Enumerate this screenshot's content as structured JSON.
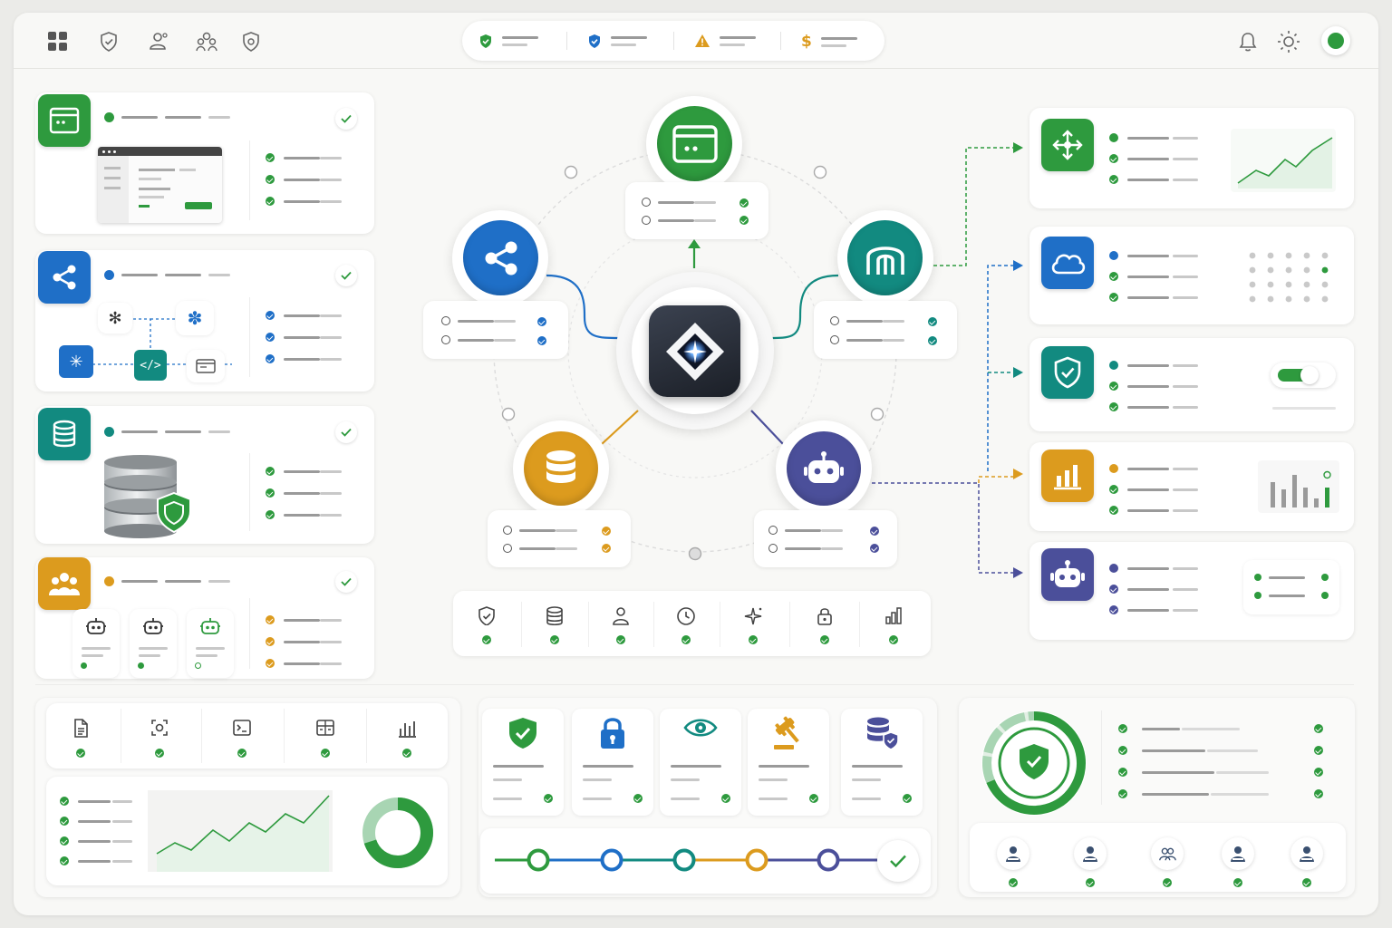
{
  "top_toolbar": {
    "left_icons": [
      "grid-icon",
      "shield-check-icon",
      "user-network-icon",
      "users-icon",
      "shield-settings-icon"
    ],
    "status_pills": [
      {
        "icon": "shield-check-icon",
        "color": "#2e9a3e"
      },
      {
        "icon": "shield-check-icon",
        "color": "#1f6fc7"
      },
      {
        "icon": "warning-icon",
        "color": "#dc9b1e"
      },
      {
        "icon": "dollar-icon",
        "color": "#dc9b1e"
      }
    ],
    "right_icons": [
      "bell-icon",
      "sun-icon",
      "status-online-icon"
    ]
  },
  "left_cards": [
    {
      "icon": "browser-window-icon",
      "color": "#2e9a3e",
      "status": "green"
    },
    {
      "icon": "share-icon",
      "color": "#1f6fc7",
      "status": "blue"
    },
    {
      "icon": "database-icon",
      "color": "#128a80",
      "status": "teal"
    },
    {
      "icon": "team-icon",
      "color": "#dc9b1e",
      "status": "orange"
    }
  ],
  "hub": {
    "center_icon": "diamond-spark-icon",
    "nodes": [
      {
        "icon": "browser-window-icon",
        "color": "#2e9a3e"
      },
      {
        "icon": "share-icon",
        "color": "#1f6fc7"
      },
      {
        "icon": "gateway-icon",
        "color": "#128a80"
      },
      {
        "icon": "database-icon",
        "color": "#dc9b1e"
      },
      {
        "icon": "robot-icon",
        "color": "#4b4f9a"
      }
    ]
  },
  "capability_bar": [
    "shield-check-icon",
    "database-icon",
    "user-icon",
    "clock-icon",
    "sparkle-icon",
    "lock-icon",
    "chart-icon"
  ],
  "right_cards": [
    {
      "icon": "move-arrows-icon",
      "color": "#2e9a3e",
      "widget": "line-chart"
    },
    {
      "icon": "cloud-icon",
      "color": "#1f6fc7",
      "widget": "dot-grid"
    },
    {
      "icon": "shield-check-icon",
      "color": "#128a80",
      "widget": "toggle",
      "toggle_on": true
    },
    {
      "icon": "bar-chart-icon",
      "color": "#dc9b1e",
      "widget": "bar-chart"
    },
    {
      "icon": "robot-icon",
      "color": "#4b4f9a",
      "widget": "list"
    }
  ],
  "bottom_left": {
    "tools": [
      "document-icon",
      "camera-scan-icon",
      "terminal-icon",
      "layout-icon",
      "bar-chart-icon"
    ],
    "donut_fraction": 0.7
  },
  "bottom_middle": {
    "policies": [
      "shield-check-icon",
      "lock-icon",
      "eye-icon",
      "gavel-icon",
      "database-shield-icon"
    ],
    "pipeline_steps": [
      "#2e9a3e",
      "#1f6fc7",
      "#128a80",
      "#dc9b1e",
      "#4b4f9a"
    ]
  },
  "bottom_right": {
    "gauge_icon": "shield-check-icon",
    "users": [
      "user-icon",
      "user-icon",
      "users-icon",
      "user-icon",
      "user-icon"
    ]
  }
}
